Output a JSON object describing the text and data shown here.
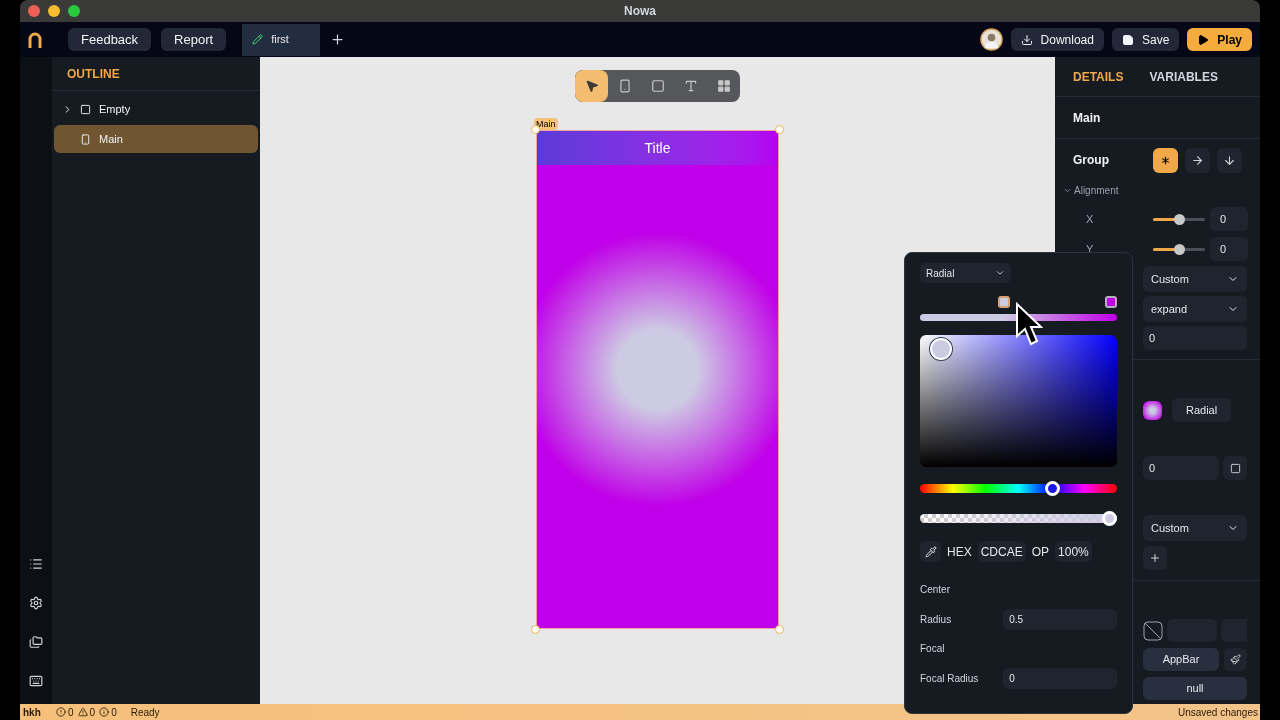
{
  "window": {
    "title": "Nowa"
  },
  "topbar": {
    "buttons": [
      "Feedback",
      "Report"
    ],
    "tabs": [
      {
        "label": "first",
        "selected": true
      }
    ],
    "actions": [
      {
        "kind": "download",
        "label": "Download"
      },
      {
        "kind": "save",
        "label": "Save"
      },
      {
        "kind": "play",
        "label": "Play"
      }
    ]
  },
  "outline": {
    "title": "OUTLINE",
    "items": [
      {
        "label": "Empty",
        "kind": "container",
        "expanded": false,
        "selected": false
      },
      {
        "label": "Main",
        "kind": "phone",
        "selected": true
      }
    ]
  },
  "canvas": {
    "tools": [
      {
        "kind": "select",
        "selected": true
      },
      {
        "kind": "phone",
        "selected": false
      },
      {
        "kind": "box",
        "selected": false
      },
      {
        "kind": "text",
        "selected": false
      },
      {
        "kind": "widgets",
        "selected": false
      }
    ],
    "selection_label": "Main",
    "app_title": "Title"
  },
  "details": {
    "tabs": [
      {
        "label": "DETAILS",
        "selected": true
      },
      {
        "label": "VARIABLES",
        "selected": false
      }
    ],
    "widget": "Main",
    "group_label": "Group",
    "directions": [
      {
        "kind": "free",
        "selected": true
      },
      {
        "kind": "row",
        "selected": false
      },
      {
        "kind": "column",
        "selected": false
      }
    ],
    "section": {
      "label": "Alignment",
      "expanded": true
    },
    "axes": [
      {
        "label": "X",
        "level": 0.5,
        "value": "0"
      },
      {
        "label": "Y",
        "level": 0.5,
        "value": "0"
      }
    ],
    "dropdown_1": "Custom",
    "dropdown_2": "expand",
    "field_1": "0",
    "fill_label": "Radial",
    "field_2": "0",
    "dropdown_3": "Custom",
    "appbar_button": "AppBar",
    "null_button": "null"
  },
  "picker": {
    "type": "Radial",
    "stops": [
      {
        "color": "#cdcae3",
        "selected": true
      },
      {
        "color": "#c000e8",
        "selected": false
      }
    ],
    "hue_slider": {
      "level": 0.67
    },
    "alpha_slider": {
      "level": 1
    },
    "hex_label": "HEX",
    "hex": "CDCAE",
    "op_label": "OP",
    "opacity": "100%",
    "params": [
      {
        "label": "Center"
      },
      {
        "label": "Radius",
        "value": "0.5"
      },
      {
        "label": "Focal"
      },
      {
        "label": "Focal Radius",
        "value": "0"
      }
    ]
  },
  "status_bar": {
    "user": "hkh",
    "errors": "0",
    "warnings": "0",
    "infos": "0",
    "state": "Ready",
    "message": "Unsaved changes"
  }
}
